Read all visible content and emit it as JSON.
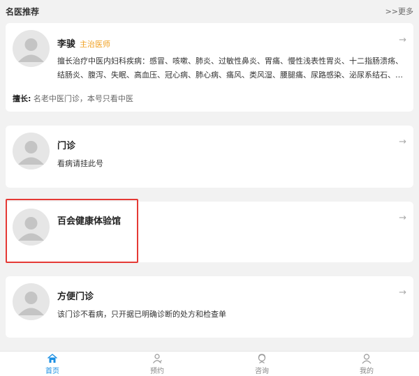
{
  "header": {
    "title": "名医推荐",
    "more": ">>更多"
  },
  "cards": [
    {
      "name": "李骏",
      "title": "主治医师",
      "description": "擅长治疗中医内妇科疾病：感冒、咳嗽、肺炎、过敏性鼻炎、胃痛、慢性浅表性胃炎、十二指肠溃疡、结肠炎、腹泻、失眠、高血压、冠心病、肺心病、痛风、类风湿、腰腿痛、尿路感染、泌尿系结石、月经不调、痛经",
      "specialty_label": "擅长:",
      "specialty_value": "名老中医门诊，本号只看中医"
    },
    {
      "name": "门诊",
      "description": "看病请挂此号"
    },
    {
      "name": "百会健康体验馆",
      "description": ""
    },
    {
      "name": "方便门诊",
      "description": "该门诊不看病，只开据已明确诊断的处方和检查单"
    }
  ],
  "tabs": [
    {
      "label": "首页",
      "icon": "home-icon",
      "active": true
    },
    {
      "label": "预约",
      "icon": "appointment-icon",
      "active": false
    },
    {
      "label": "咨询",
      "icon": "consult-icon",
      "active": false
    },
    {
      "label": "我的",
      "icon": "user-icon",
      "active": false
    }
  ],
  "colors": {
    "accent": "#1a8fe3",
    "title_orange": "#f0a020",
    "highlight_red": "#e53935"
  },
  "arrow_glyph": "→"
}
